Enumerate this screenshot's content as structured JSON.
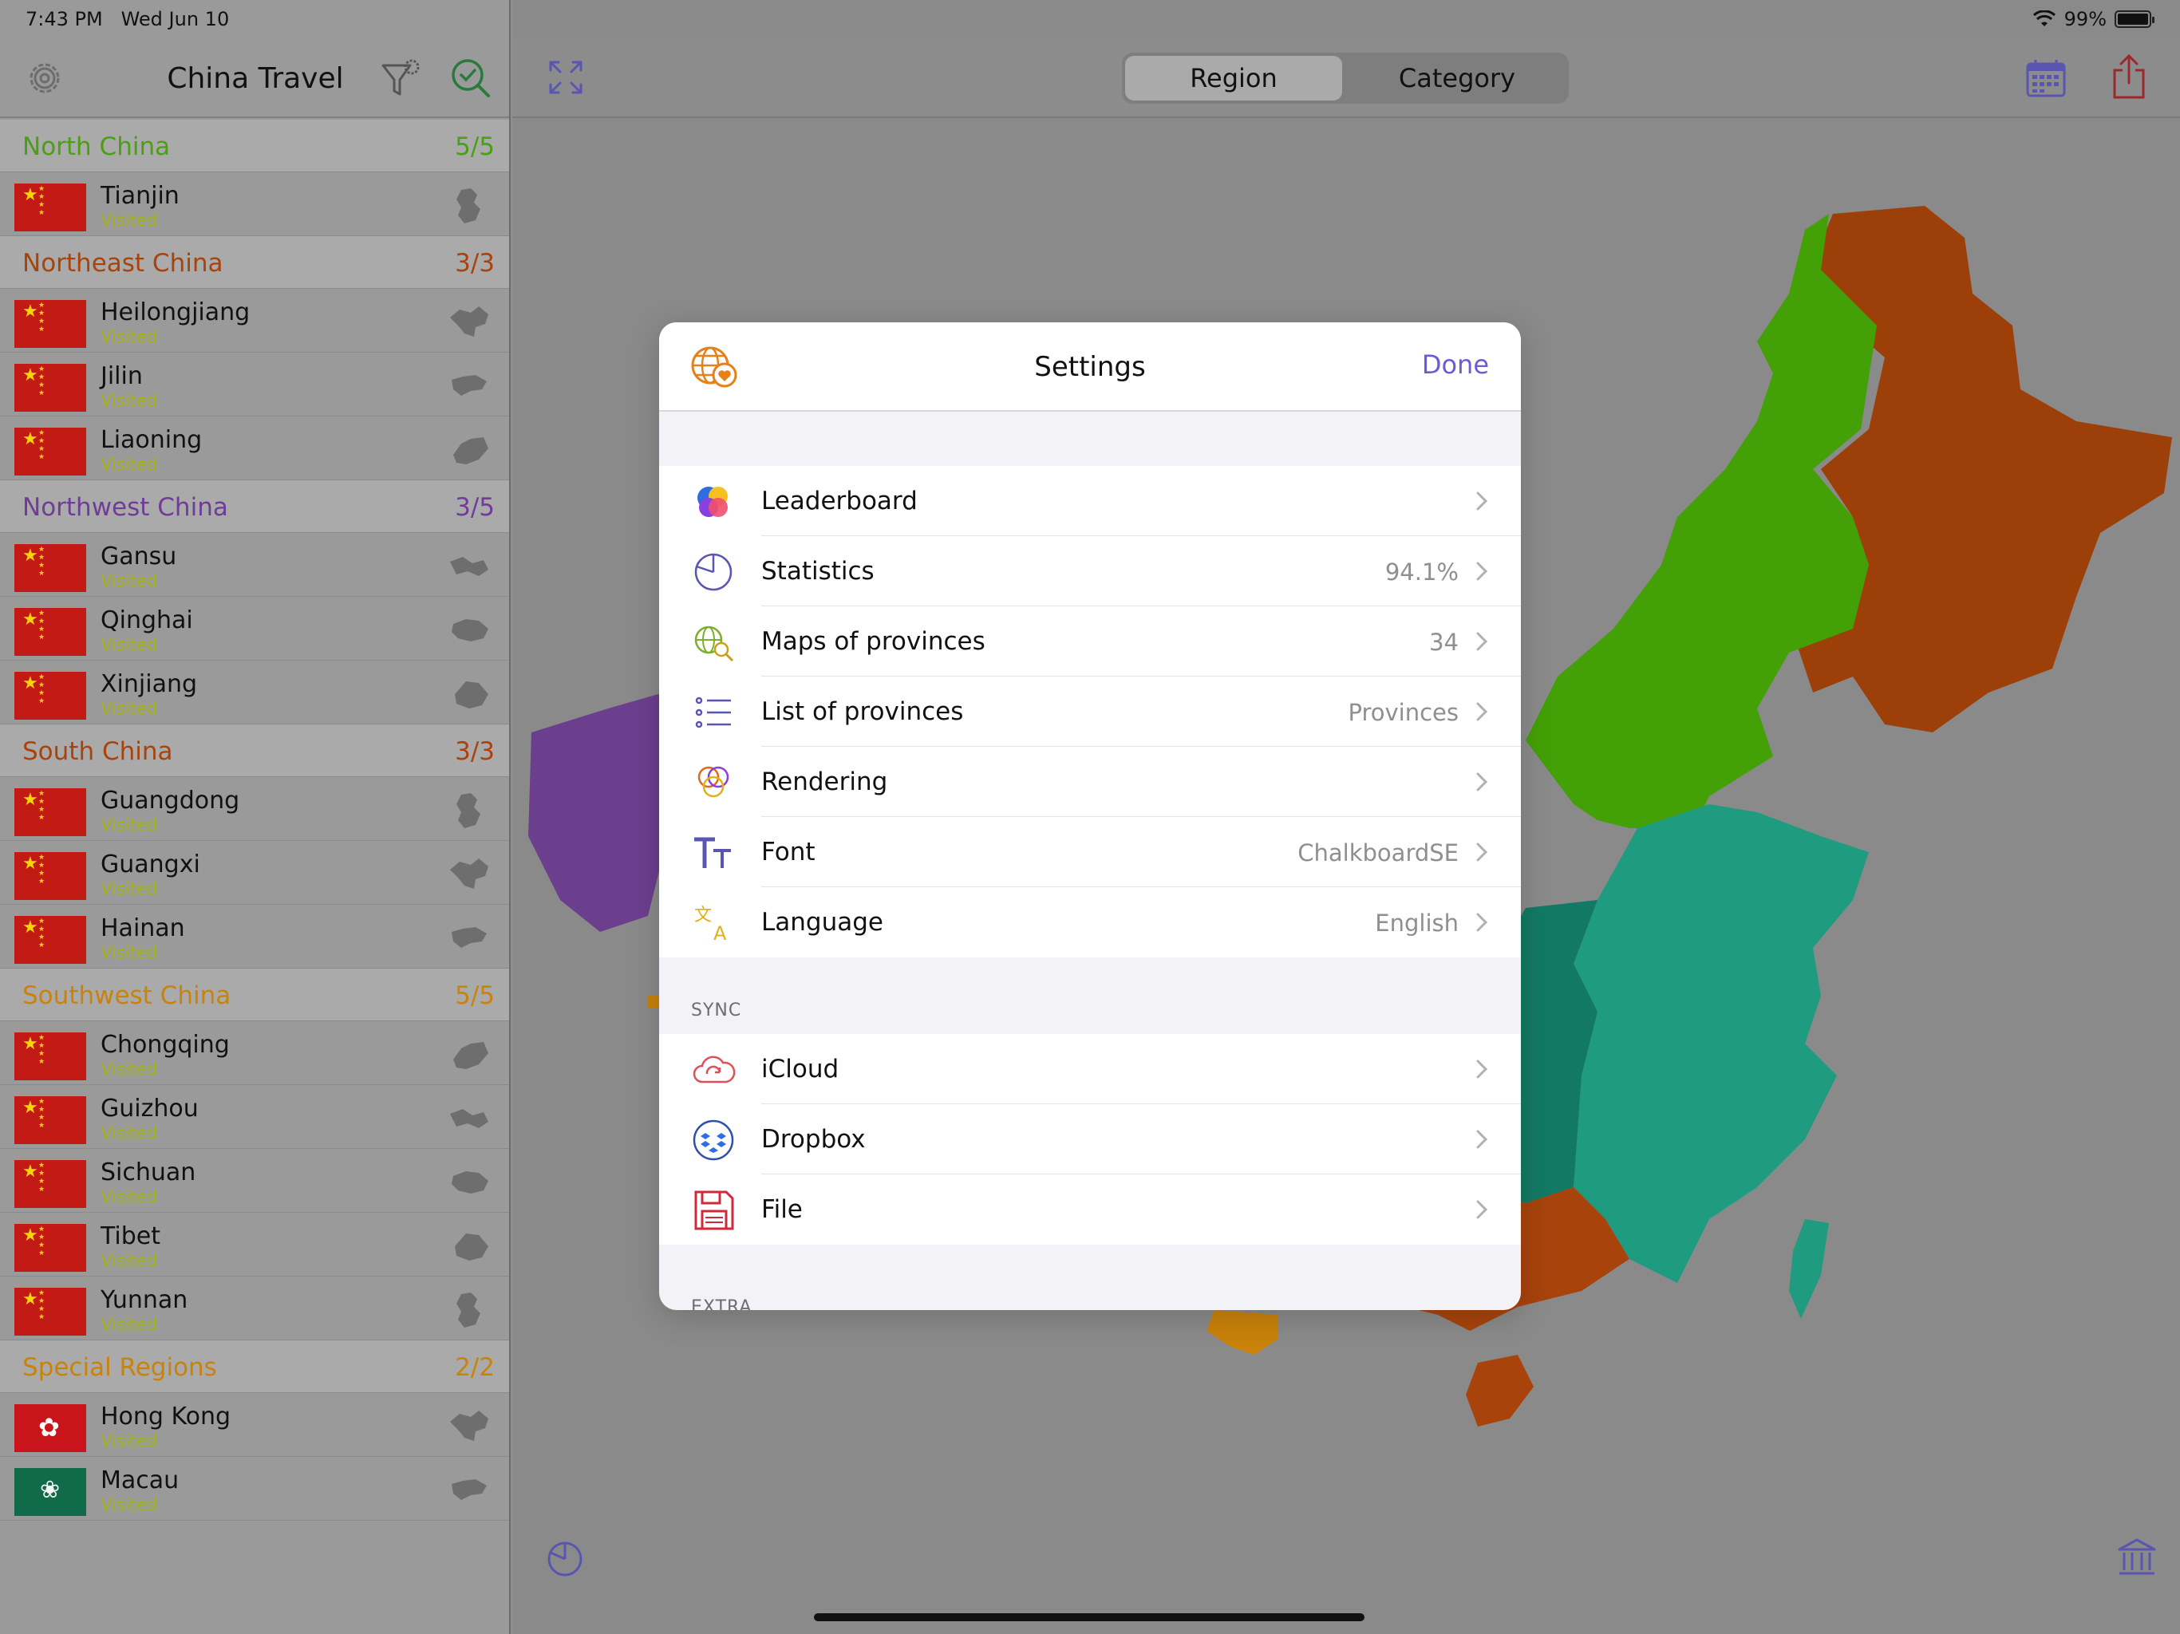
{
  "status_bar": {
    "time": "7:43 PM",
    "date": "Wed Jun 10",
    "battery": "99%"
  },
  "sidebar": {
    "title": "China Travel",
    "sections": [
      {
        "title": "North China",
        "count": "5/5",
        "color": "#4aa012",
        "items": [
          {
            "name": "Tianjin",
            "status": "Visited",
            "flag": "china-flag"
          }
        ]
      },
      {
        "title": "Northeast China",
        "count": "3/3",
        "color": "#a8430c",
        "items": [
          {
            "name": "Heilongjiang",
            "status": "Visited",
            "flag": "china-flag"
          },
          {
            "name": "Jilin",
            "status": "Visited",
            "flag": "china-flag"
          },
          {
            "name": "Liaoning",
            "status": "Visited",
            "flag": "china-flag"
          }
        ]
      },
      {
        "title": "Northwest China",
        "count": "3/5",
        "color": "#6f3c98",
        "items": [
          {
            "name": "Gansu",
            "status": "Visited",
            "flag": "china-flag"
          },
          {
            "name": "Qinghai",
            "status": "Visited",
            "flag": "china-flag"
          },
          {
            "name": "Xinjiang",
            "status": "Visited",
            "flag": "china-flag"
          }
        ]
      },
      {
        "title": "South China",
        "count": "3/3",
        "color": "#a8430c",
        "items": [
          {
            "name": "Guangdong",
            "status": "Visited",
            "flag": "china-flag"
          },
          {
            "name": "Guangxi",
            "status": "Visited",
            "flag": "china-flag"
          },
          {
            "name": "Hainan",
            "status": "Visited",
            "flag": "china-flag"
          }
        ]
      },
      {
        "title": "Southwest China",
        "count": "5/5",
        "color": "#c9820a",
        "items": [
          {
            "name": "Chongqing",
            "status": "Visited",
            "flag": "china-flag"
          },
          {
            "name": "Guizhou",
            "status": "Visited",
            "flag": "china-flag"
          },
          {
            "name": "Sichuan",
            "status": "Visited",
            "flag": "china-flag"
          },
          {
            "name": "Tibet",
            "status": "Visited",
            "flag": "china-flag"
          },
          {
            "name": "Yunnan",
            "status": "Visited",
            "flag": "china-flag"
          }
        ]
      },
      {
        "title": "Special Regions",
        "count": "2/2",
        "color": "#c9820a",
        "items": [
          {
            "name": "Hong Kong",
            "status": "Visited",
            "flag": "hong-kong-flag"
          },
          {
            "name": "Macau",
            "status": "Visited",
            "flag": "macau-flag"
          }
        ]
      }
    ]
  },
  "toolbar": {
    "segments": [
      "Region",
      "Category"
    ],
    "selected_segment": "Region",
    "icons": [
      "expand-icon",
      "calendar-icon",
      "share-icon"
    ]
  },
  "settings": {
    "title": "Settings",
    "done_label": "Done",
    "main_items": [
      {
        "label": "Leaderboard",
        "value": "",
        "icon": "leaderboard-icon"
      },
      {
        "label": "Statistics",
        "value": "94.1%",
        "icon": "pie-chart-icon"
      },
      {
        "label": "Maps of provinces",
        "value": "34",
        "icon": "globe-search-icon"
      },
      {
        "label": "List of provinces",
        "value": "Provinces",
        "icon": "list-icon"
      },
      {
        "label": "Rendering",
        "value": "",
        "icon": "color-circles-icon"
      },
      {
        "label": "Font",
        "value": "ChalkboardSE",
        "icon": "font-icon"
      },
      {
        "label": "Language",
        "value": "English",
        "icon": "translate-icon"
      }
    ],
    "sync_header": "SYNC",
    "sync_items": [
      {
        "label": "iCloud",
        "value": "",
        "icon": "icloud-icon"
      },
      {
        "label": "Dropbox",
        "value": "",
        "icon": "dropbox-icon"
      },
      {
        "label": "File",
        "value": "",
        "icon": "floppy-disk-icon"
      }
    ],
    "extra_header": "EXTRA"
  },
  "colors": {
    "north": "#3e8f08",
    "northeast": "#983d08",
    "east": "#1f8a72",
    "northwest": "#6c3f8e",
    "accent": "#6a5bd6"
  }
}
